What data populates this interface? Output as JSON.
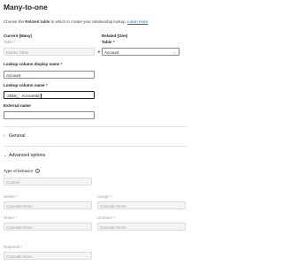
{
  "title": "Many-to-one",
  "description": {
    "prefix": "Choose the ",
    "bold": "Related table",
    "suffix": " to which to create your relationship lookup. ",
    "link": "Learn more"
  },
  "current": {
    "heading": "Current (Many)",
    "table_label": "Table",
    "table_value": "Elastic Table"
  },
  "related": {
    "heading": "Related (One)",
    "table_label": "Table",
    "table_value": "Account"
  },
  "connector": {
    "many": "∗",
    "one": "1"
  },
  "lookup_display": {
    "label": "Lookup column display name",
    "value": "Account"
  },
  "lookup_name": {
    "label": "Lookup column name",
    "prefix": "crt1e_",
    "value": "AccountId"
  },
  "external_name": {
    "label": "External name",
    "value": ""
  },
  "general": {
    "label": "General",
    "icon": "chevron-right-icon"
  },
  "advanced": {
    "label": "Advanced options",
    "icon": "chevron-down-icon"
  },
  "behavior": {
    "label": "Type of behavior",
    "value": "Custom"
  },
  "delete": {
    "label": "Delete",
    "value": "Cascade None"
  },
  "assign": {
    "label": "Assign",
    "value": "Cascade None"
  },
  "share": {
    "label": "Share",
    "value": "Cascade None"
  },
  "unshare": {
    "label": "Unshare",
    "value": "Cascade None"
  },
  "reparent": {
    "label": "Reparent",
    "value": "Cascade None"
  },
  "required_marker": "*",
  "info_icon": "i"
}
